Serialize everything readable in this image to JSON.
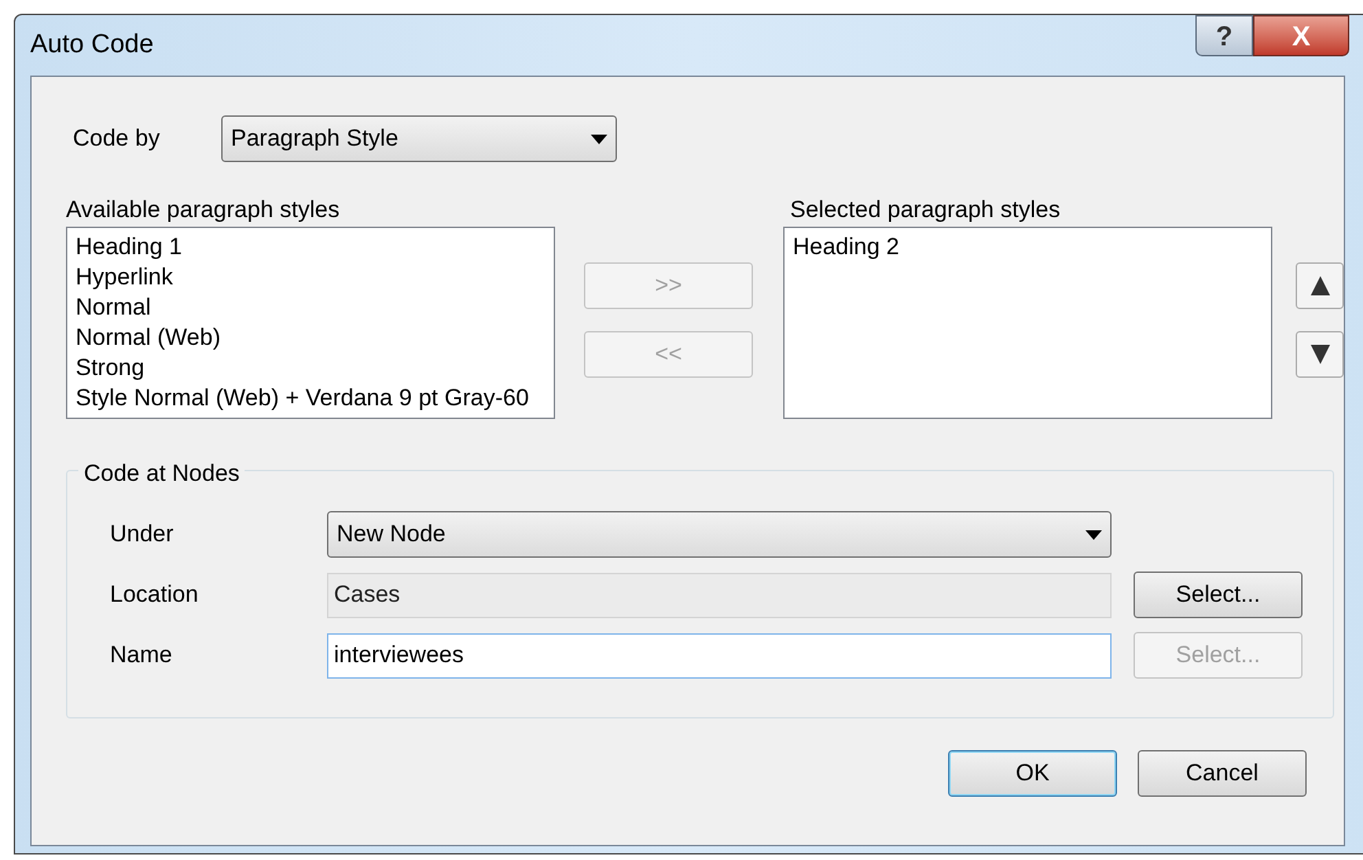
{
  "window": {
    "title": "Auto Code",
    "help_button": "?",
    "close_button": "X"
  },
  "code_by": {
    "label": "Code by",
    "value": "Paragraph Style"
  },
  "available": {
    "label": "Available paragraph styles",
    "items": [
      "Heading 1",
      "Hyperlink",
      "Normal",
      "Normal (Web)",
      "Strong",
      "Style Normal (Web) + Verdana 9 pt Gray-60"
    ]
  },
  "transfer_buttons": [
    {
      "label": ">>",
      "disabled": true
    },
    {
      "label": "<<",
      "disabled": true
    }
  ],
  "selected": {
    "label": "Selected paragraph styles",
    "items": [
      "Heading 2"
    ]
  },
  "order_buttons": [
    {
      "kind": "up"
    },
    {
      "kind": "down"
    }
  ],
  "code_at_nodes": {
    "title": "Code at Nodes",
    "under": {
      "label": "Under",
      "value": "New Node"
    },
    "location": {
      "label": "Location",
      "value": "Cases",
      "readonly": true,
      "button": {
        "label": "Select...",
        "disabled": false
      }
    },
    "name": {
      "label": "Name",
      "value": "interviewees",
      "readonly": false,
      "button": {
        "label": "Select...",
        "disabled": true
      }
    }
  },
  "buttons": [
    {
      "label": "OK",
      "default": true
    },
    {
      "label": "Cancel",
      "default": false
    }
  ]
}
